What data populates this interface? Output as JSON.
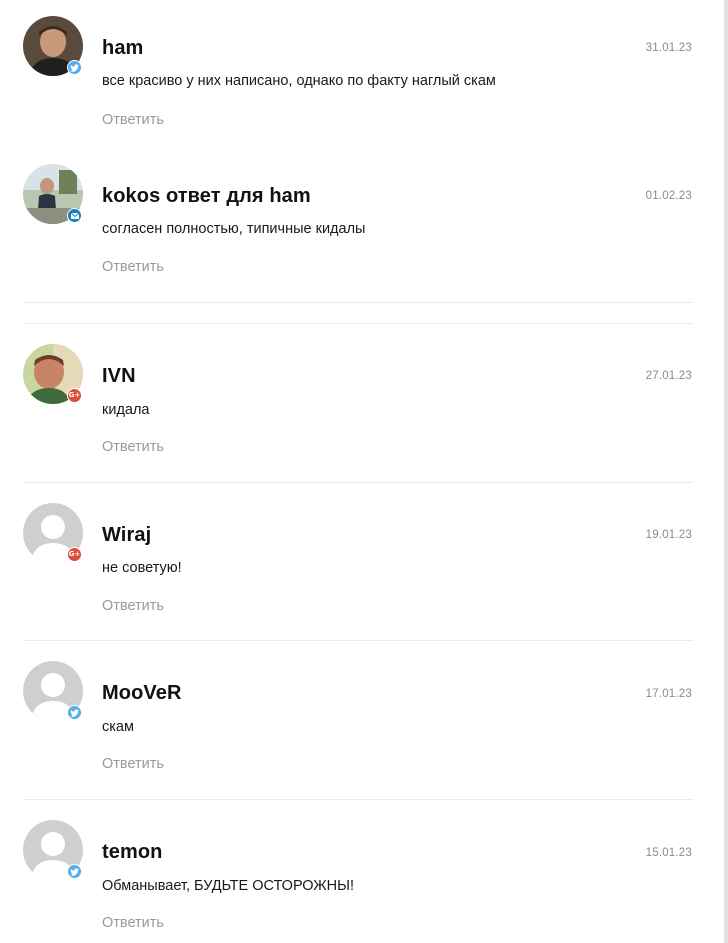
{
  "reply_label": "Ответить",
  "colors": {
    "twitter": "#55acee",
    "google": "#dd4b39",
    "mail": "#1a7fc1",
    "avatar_placeholder": "#cfcfcf"
  },
  "comments": [
    {
      "author": "ham",
      "date": "31.01.23",
      "text": "все красиво у них написано, однако по факту наглый скам",
      "social": "twitter-icon",
      "avatar": "photo"
    },
    {
      "author": "kokos ответ для ham",
      "date": "01.02.23",
      "text": "согласен полностью, типичные кидалы",
      "social": "mail-icon",
      "avatar": "photo"
    },
    {
      "author": "IVN",
      "date": "27.01.23",
      "text": "кидала",
      "social": "google-plus-icon",
      "avatar": "photo"
    },
    {
      "author": "Wiraj",
      "date": "19.01.23",
      "text": "не советую!",
      "social": "google-plus-icon",
      "avatar": "placeholder"
    },
    {
      "author": "MooVeR",
      "date": "17.01.23",
      "text": "скам",
      "social": "twitter-icon",
      "avatar": "placeholder"
    },
    {
      "author": "temon",
      "date": "15.01.23",
      "text": "Обманывает, БУДЬТЕ ОСТОРОЖНЫ!",
      "social": "twitter-icon",
      "avatar": "placeholder"
    }
  ]
}
